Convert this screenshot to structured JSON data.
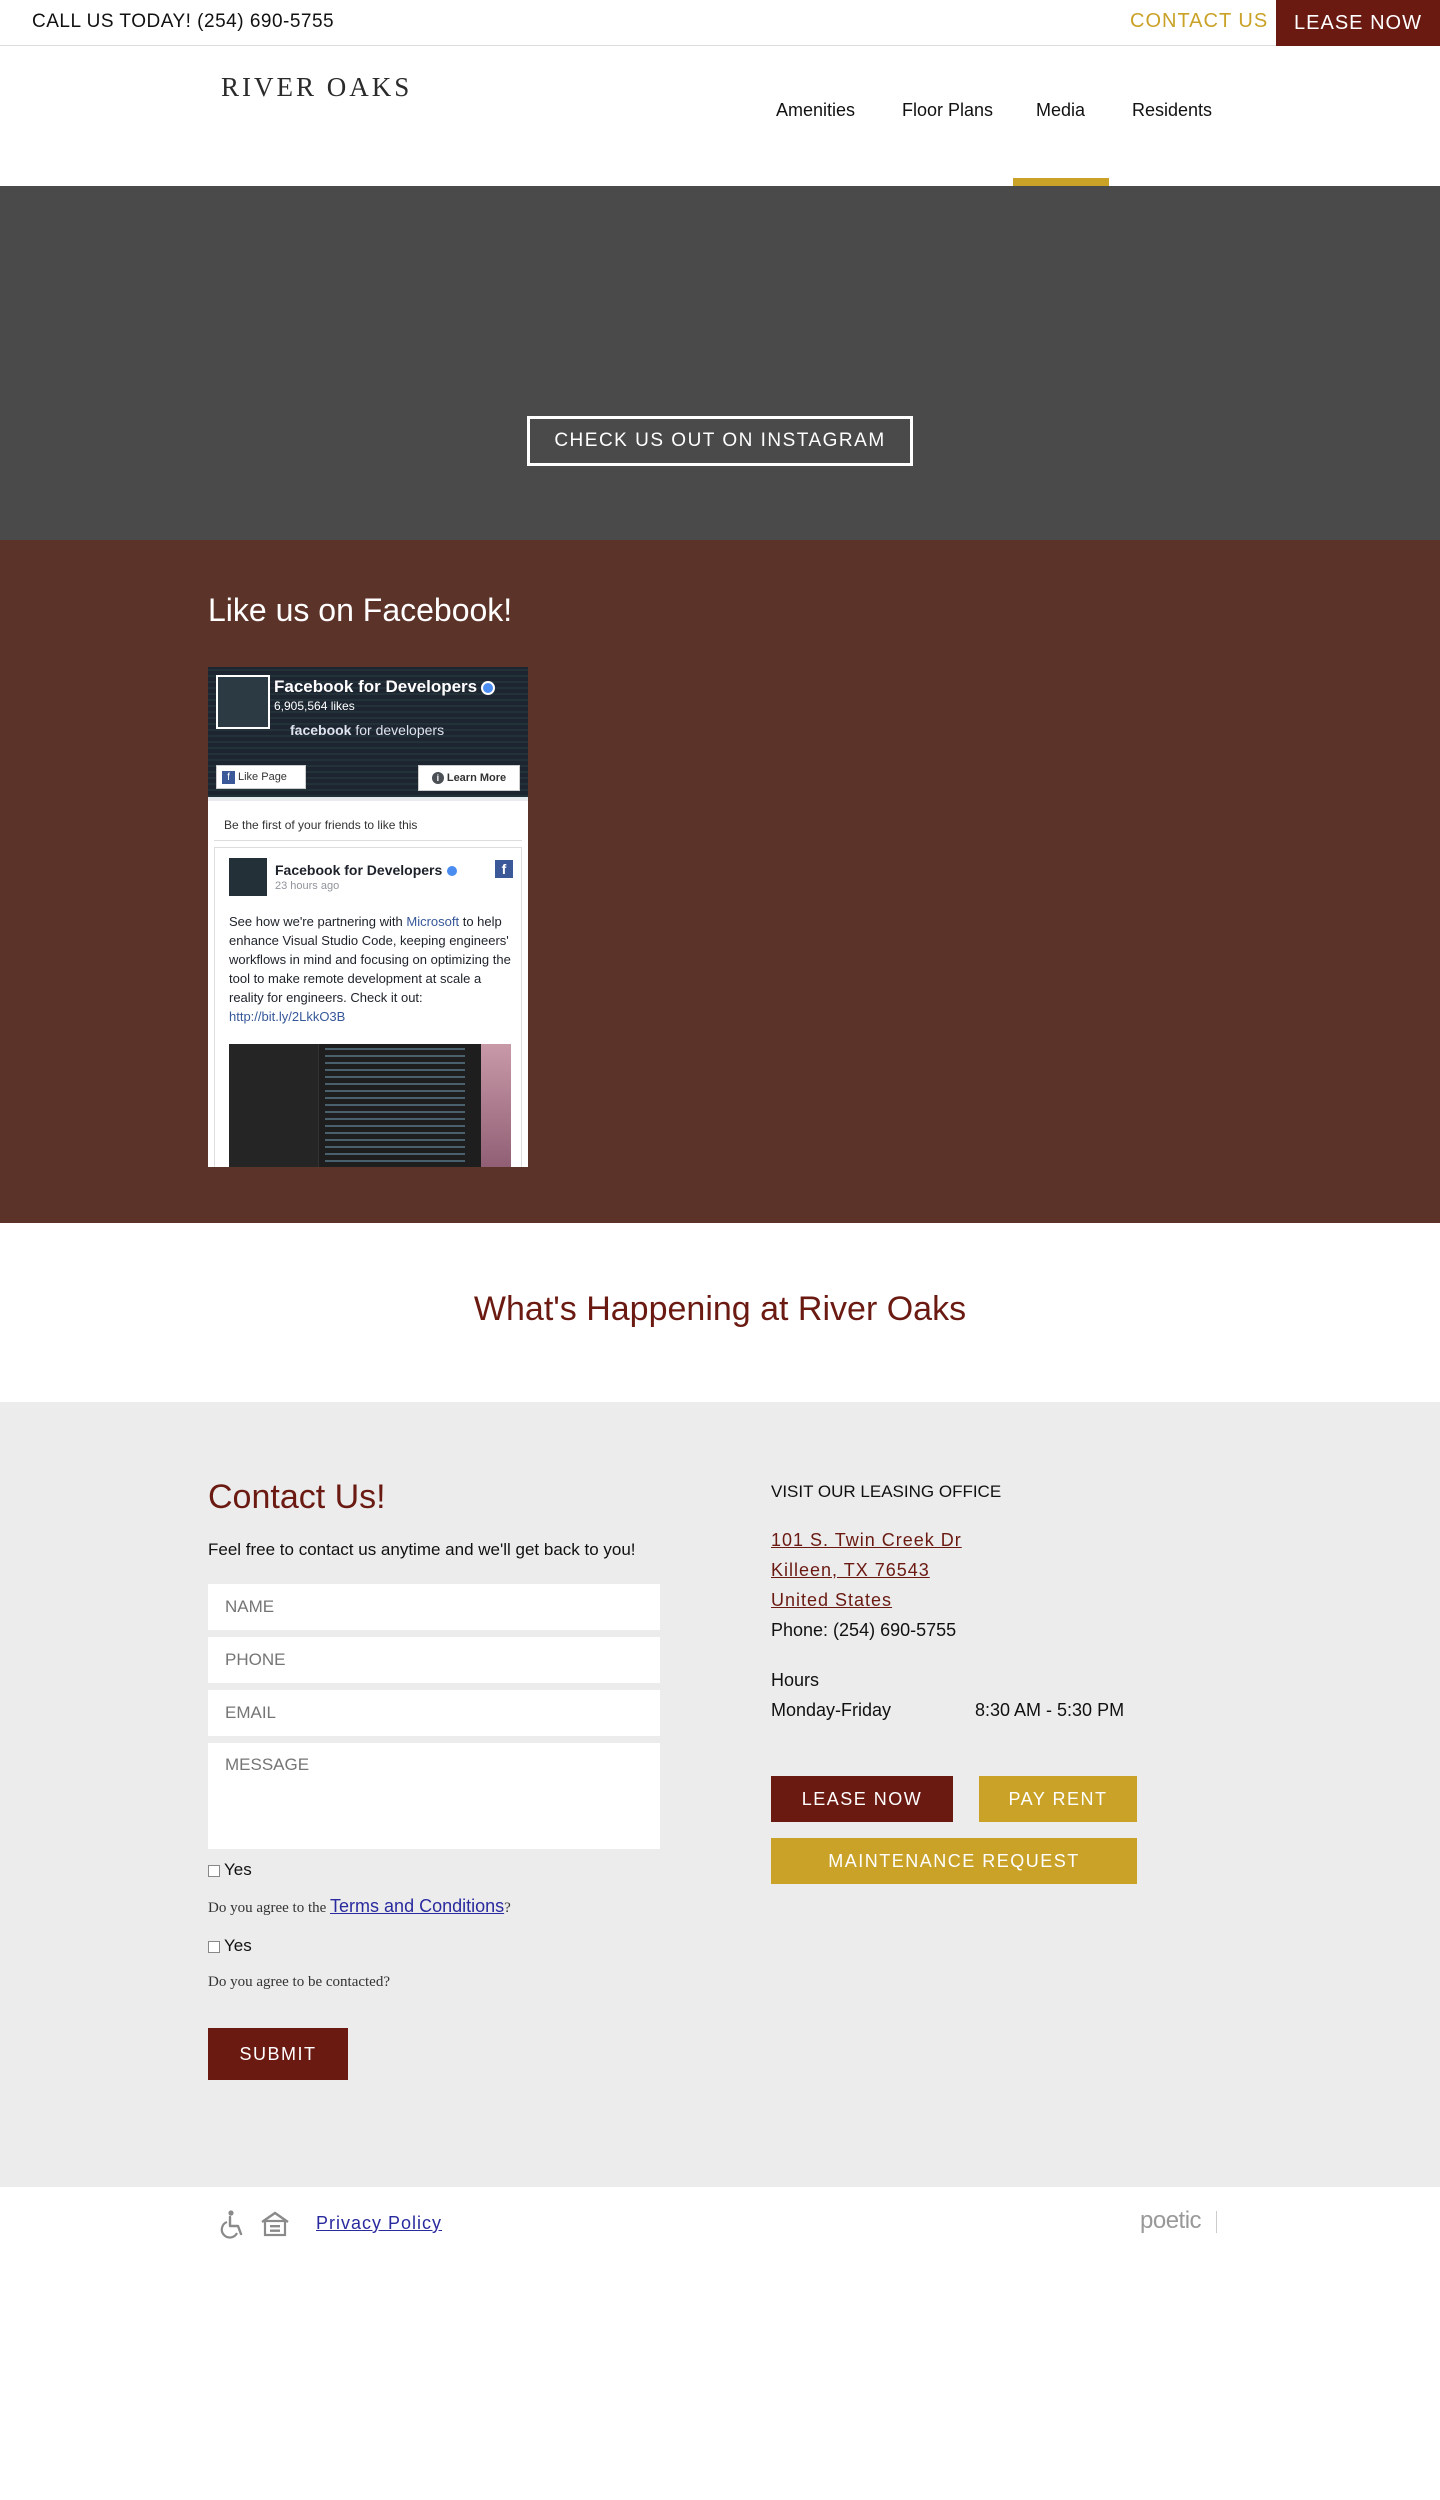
{
  "topbar": {
    "phone": "CALL US TODAY! (254) 690-5755",
    "contact_label": "CONTACT US",
    "lease_label": "LEASE NOW"
  },
  "header": {
    "logo": "RIVER OAKS",
    "nav": [
      {
        "label": "Amenities"
      },
      {
        "label": "Floor Plans"
      },
      {
        "label": "Media",
        "active": true
      },
      {
        "label": "Residents"
      }
    ]
  },
  "hero": {
    "button_label": "CHECK US OUT ON INSTAGRAM"
  },
  "facebook": {
    "title": "Like us on Facebook!",
    "widget": {
      "page_name": "Facebook for Developers",
      "likes": "6,905,564 likes",
      "brand_bold": "facebook",
      "brand_rest": " for developers",
      "like_page": "Like Page",
      "learn_more": "Learn More",
      "friends_text": "Be the first of your friends to like this",
      "post_author": "Facebook for Developers",
      "post_time": "23 hours ago",
      "post_text_1": "See how we're partnering with ",
      "post_link_1": "Microsoft",
      "post_text_2": " to help enhance Visual Studio Code, keeping engineers' workflows in mind and focusing on optimizing the tool to make remote development at scale a reality for engineers. Check it out: ",
      "post_link_2": "http://bit.ly/2LkkO3B"
    }
  },
  "happening": {
    "title": "What's Happening at River Oaks"
  },
  "contact": {
    "title": "Contact Us!",
    "subtitle": "Feel free to contact us anytime and we'll get back to you!",
    "placeholders": {
      "name": "NAME",
      "phone": "PHONE",
      "email": "EMAIL",
      "message": "MESSAGE"
    },
    "checkbox_label": "Yes",
    "agree_terms_prefix": "Do you agree to the ",
    "agree_terms_link": "Terms and Conditions",
    "agree_terms_suffix": "?",
    "agree_contact": "Do you agree to be contacted?",
    "submit_label": "SUBMIT",
    "office": {
      "title": "VISIT OUR LEASING OFFICE",
      "address_line1": "101 S. Twin Creek Dr",
      "address_line2": "Killeen, TX 76543",
      "address_line3": "United States",
      "phone": "Phone: (254) 690-5755",
      "hours_title": "Hours",
      "hours_day": "Monday-Friday",
      "hours_time": "8:30 AM - 5:30 PM"
    },
    "buttons": {
      "lease": "LEASE NOW",
      "pay": "PAY RENT",
      "maintenance": "MAINTENANCE REQUEST"
    }
  },
  "footer": {
    "privacy": "Privacy Policy",
    "credit": "poetic"
  },
  "colors": {
    "brand_maroon": "#6b1a12",
    "brand_gold": "#c9a227",
    "hero_gray": "#4a4a4a",
    "fb_section_brown": "#5c3328",
    "contact_bg": "#ececec"
  }
}
